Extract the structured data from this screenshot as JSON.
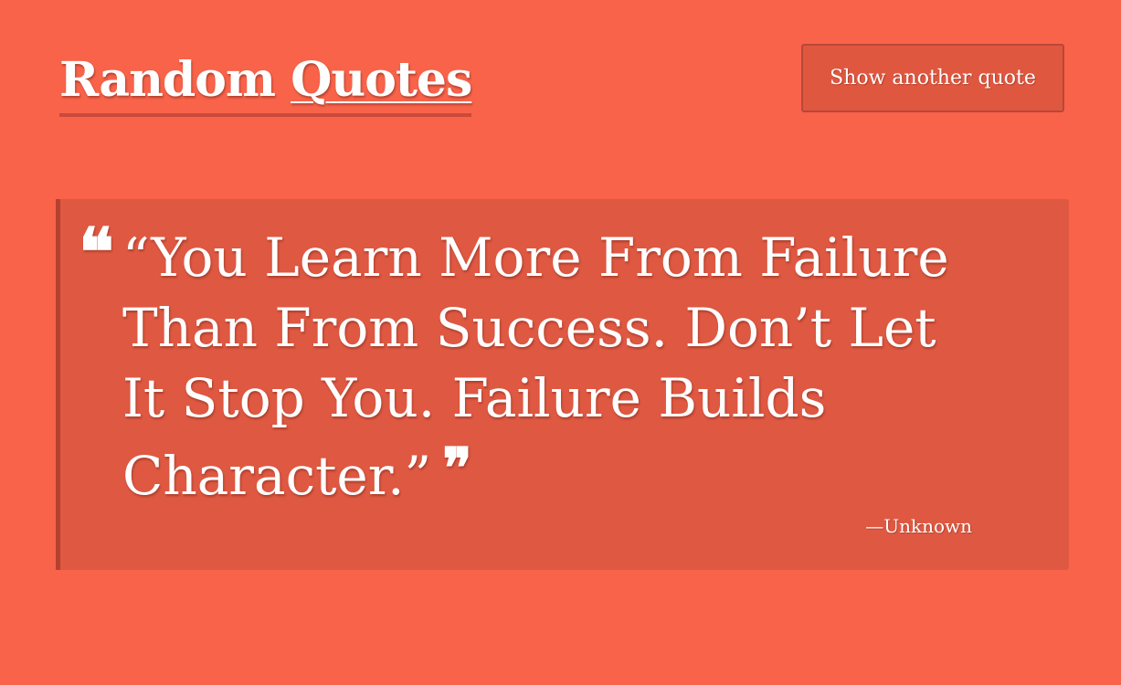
{
  "header": {
    "title_word1": "Random",
    "title_word2": "Quotes",
    "button_label": "Show another quote"
  },
  "quote": {
    "open_mark": "❝",
    "text": "“You Learn More From Failure Than From Success. Don’t Let It Stop You. Failure Builds Character.”",
    "close_mark": "❞",
    "author": "—Unknown"
  },
  "colors": {
    "background": "#f8634a",
    "card": "#df5842",
    "card_border": "#b4412f",
    "button": "#e0573f",
    "text": "#ffffff"
  },
  "icons": {
    "open_quote": "open-quote-icon",
    "close_quote": "close-quote-icon"
  }
}
